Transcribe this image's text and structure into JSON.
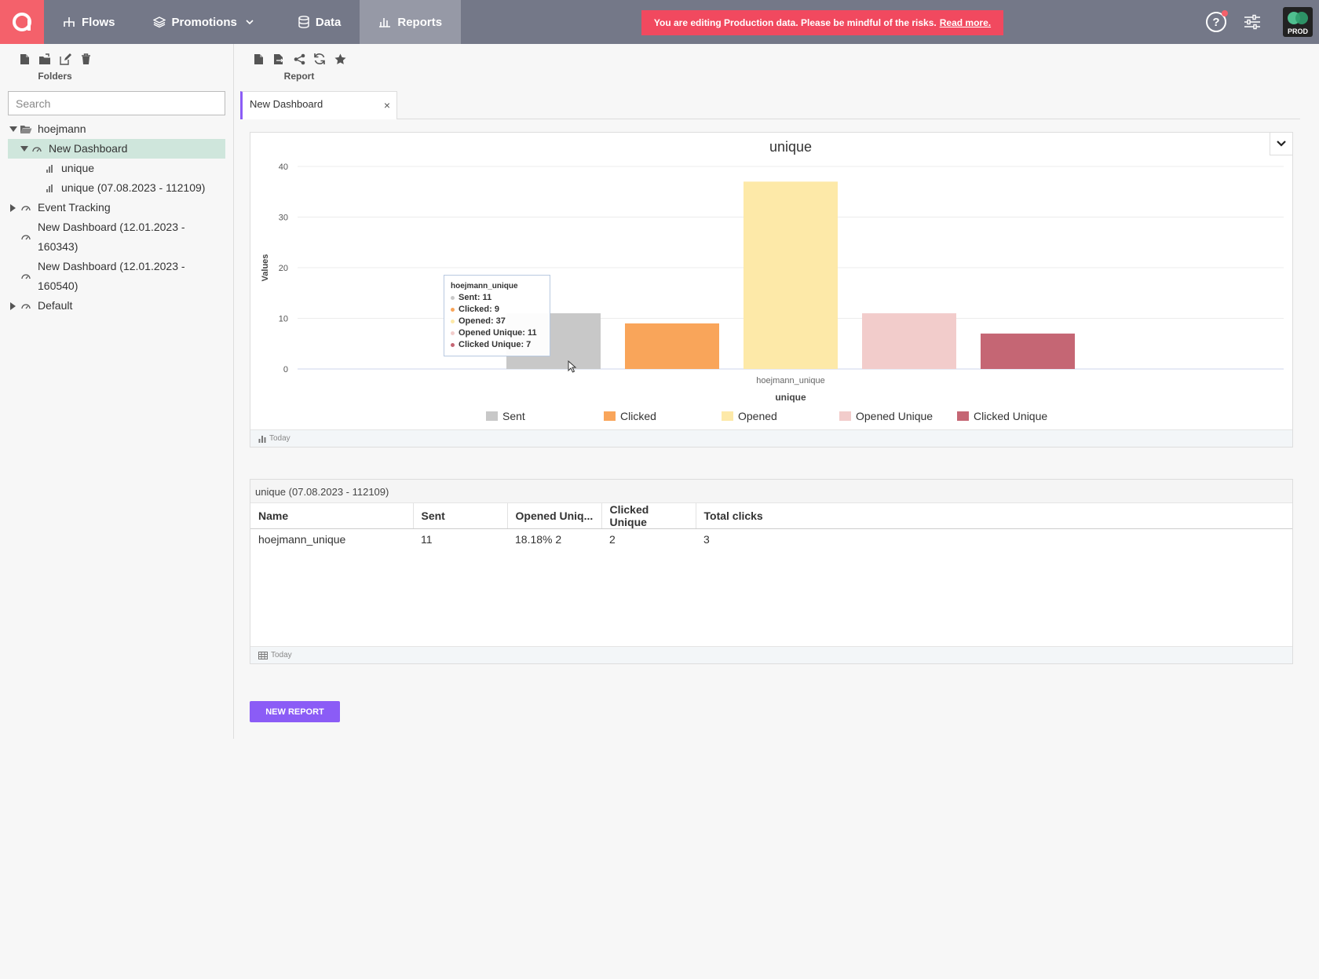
{
  "nav": {
    "items": [
      {
        "label": "Flows",
        "icon": "flows-icon"
      },
      {
        "label": "Promotions",
        "icon": "layers-icon"
      },
      {
        "label": "Data",
        "icon": "database-icon"
      },
      {
        "label": "Reports",
        "icon": "bar-chart-icon"
      }
    ],
    "banner_text": "You are editing Production data. Please be mindful of the risks.",
    "banner_link": "Read more.",
    "env_label": "PROD",
    "help_glyph": "?"
  },
  "sidebar": {
    "toolbar_caption": "Folders",
    "search_placeholder": "Search",
    "tree": [
      {
        "label": "hoejmann",
        "icon": "folder-open-icon",
        "expanded": true
      },
      {
        "label": "New Dashboard",
        "icon": "dashboard-icon",
        "expanded": true,
        "selected": true
      },
      {
        "label": "unique",
        "icon": "bar-chart-icon"
      },
      {
        "label": "unique (07.08.2023 - 112109)",
        "icon": "bar-chart-icon"
      },
      {
        "label": "Event Tracking",
        "icon": "dashboard-icon",
        "expanded": false
      },
      {
        "label_line1": "New Dashboard (12.01.2023 -",
        "label_line2": "160343)",
        "icon": "dashboard-icon"
      },
      {
        "label_line1": "New Dashboard (12.01.2023 -",
        "label_line2": "160540)",
        "icon": "dashboard-icon"
      },
      {
        "label": "Default",
        "icon": "dashboard-icon",
        "expanded": false
      }
    ]
  },
  "report_toolbar": {
    "caption": "Report"
  },
  "tab": {
    "label": "New Dashboard",
    "close": "×"
  },
  "chart_card": {
    "footer_label": "Today",
    "tooltip": {
      "title": "hoejmann_unique",
      "rows": [
        "Sent: 11",
        "Clicked: 9",
        "Opened: 37",
        "Opened Unique: 11",
        "Clicked Unique: 7"
      ]
    }
  },
  "chart_data": {
    "type": "bar",
    "title": "unique",
    "xlabel": "unique",
    "ylabel": "Values",
    "categories": [
      "hoejmann_unique"
    ],
    "series": [
      {
        "name": "Sent",
        "values": [
          11
        ],
        "color": "#c8c8c8"
      },
      {
        "name": "Clicked",
        "values": [
          9
        ],
        "color": "#f9a55a"
      },
      {
        "name": "Opened",
        "values": [
          37
        ],
        "color": "#fde9a8"
      },
      {
        "name": "Opened Unique",
        "values": [
          11
        ],
        "color": "#f2cccb"
      },
      {
        "name": "Clicked Unique",
        "values": [
          7
        ],
        "color": "#c56674"
      }
    ],
    "ylim": [
      0,
      40
    ],
    "yticks": [
      0,
      10,
      20,
      30,
      40
    ],
    "grid": true,
    "legend": "bottom"
  },
  "table_card": {
    "title": "unique (07.08.2023 - 112109)",
    "columns": [
      "Name",
      "Sent",
      "Opened Uniq...",
      "Clicked Unique",
      "Total clicks"
    ],
    "rows": [
      [
        "hoejmann_unique",
        "11",
        "18.18% 2",
        "2",
        "3"
      ]
    ],
    "footer_label": "Today"
  },
  "new_report_button": "NEW REPORT",
  "colors": {
    "accent": "#8b5cf6",
    "brand": "#f4616b",
    "nav_bg": "#747888",
    "banner": "#f1495f",
    "selected_row": "#cfe6dc"
  }
}
